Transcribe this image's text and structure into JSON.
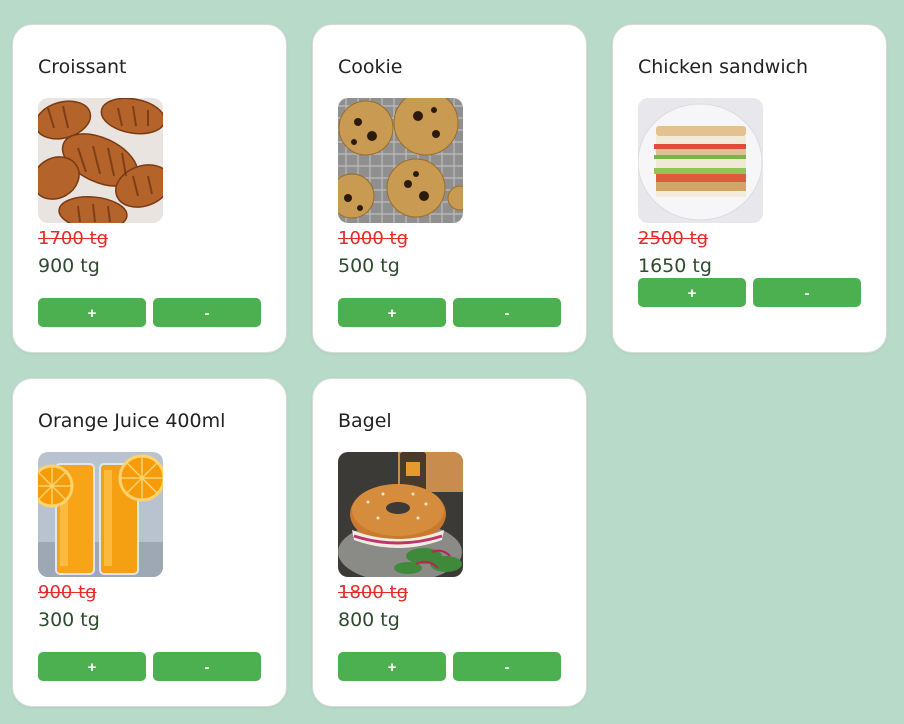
{
  "colors": {
    "page_background": "#b8dbc9",
    "card_background": "#ffffff",
    "button_green": "#4caf50",
    "old_price_red": "#e52a2a",
    "new_price_text": "#2f4b2f"
  },
  "products": [
    {
      "name": "Croissant",
      "image": "croissant-photo",
      "old_price": "1700 tg",
      "price": "900 tg",
      "plus_label": "+",
      "minus_label": "-"
    },
    {
      "name": "Cookie",
      "image": "cookie-photo",
      "old_price": "1000 tg",
      "price": "500 tg",
      "plus_label": "+",
      "minus_label": "-"
    },
    {
      "name": "Chicken sandwich",
      "image": "sandwich-photo",
      "old_price": "2500 tg",
      "price": "1650 tg",
      "plus_label": "+",
      "minus_label": "-"
    },
    {
      "name": "Orange Juice 400ml",
      "image": "orange-juice-photo",
      "old_price": "900 tg",
      "price": "300 tg",
      "plus_label": "+",
      "minus_label": "-"
    },
    {
      "name": "Bagel",
      "image": "bagel-photo",
      "old_price": "1800 tg",
      "price": "800 tg",
      "plus_label": "+",
      "minus_label": "-"
    }
  ]
}
